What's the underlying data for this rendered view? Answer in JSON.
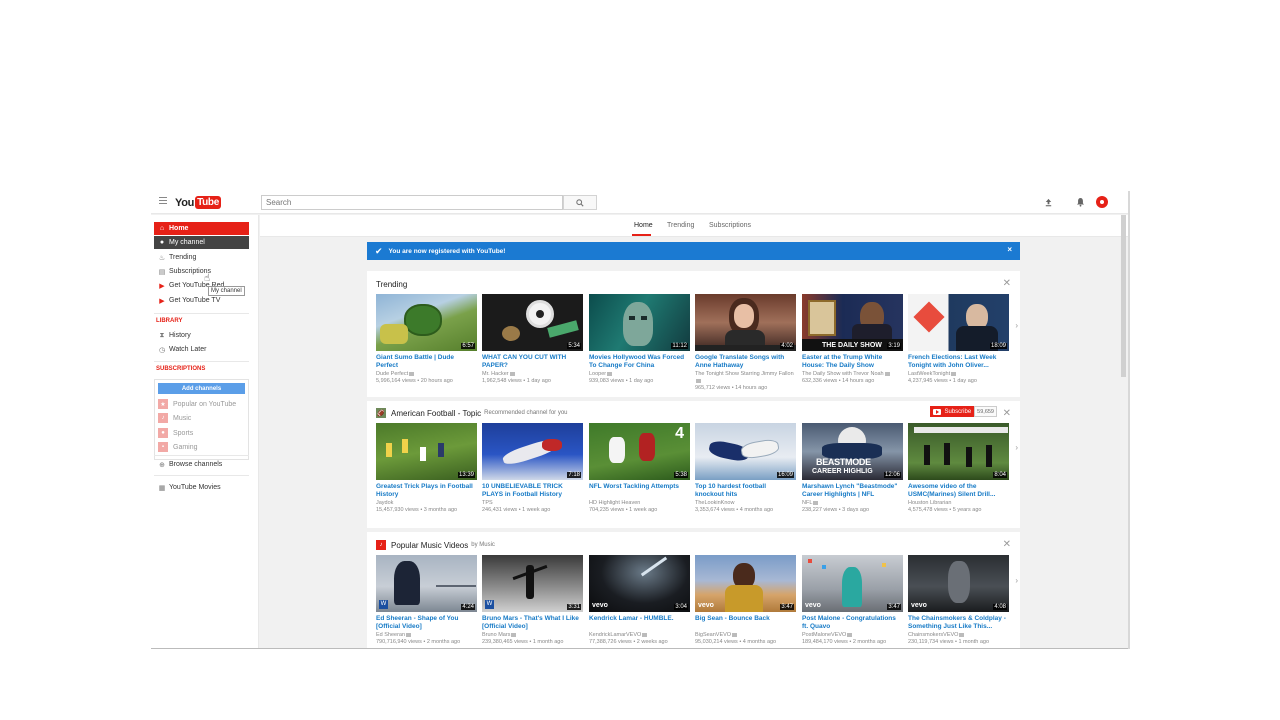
{
  "masthead": {
    "logo_you": "You",
    "logo_tube": "Tube",
    "search_placeholder": "Search"
  },
  "guide": {
    "items": [
      {
        "label": "Home",
        "icon": "home-icon"
      },
      {
        "label": "My channel",
        "icon": "person-icon"
      },
      {
        "label": "Trending",
        "icon": "flame-icon"
      },
      {
        "label": "Subscriptions",
        "icon": "subscriptions-icon"
      },
      {
        "label": "Get YouTube Red",
        "icon": "youtube-red-icon"
      },
      {
        "label": "Get YouTube TV",
        "icon": "youtube-tv-icon"
      }
    ],
    "library_heading": "LIBRARY",
    "library": [
      {
        "label": "History",
        "icon": "hourglass-icon"
      },
      {
        "label": "Watch Later",
        "icon": "clock-icon"
      }
    ],
    "subscriptions_heading": "SUBSCRIPTIONS",
    "add_channels": "Add channels",
    "subscriptions": [
      "Popular on YouTube",
      "Music",
      "Sports",
      "Gaming"
    ],
    "browse_channels": "Browse channels",
    "youtube_movies": "YouTube Movies",
    "tooltip": "My channel"
  },
  "tabs": [
    "Home",
    "Trending",
    "Subscriptions"
  ],
  "banner": {
    "text": "You are now registered with YouTube!",
    "close": "×"
  },
  "shelves": [
    {
      "title": "Trending",
      "subtitle": "",
      "videos": [
        {
          "title": "Giant Sumo Battle | Dude Perfect",
          "channel": "Dude Perfect",
          "meta": "5,996,164 views • 20 hours ago",
          "duration": "6:57"
        },
        {
          "title": "WHAT CAN YOU CUT WITH PAPER?",
          "channel": "Mr. Hacker",
          "meta": "1,962,548 views • 1 day ago",
          "duration": "5:34"
        },
        {
          "title": "Movies Hollywood Was Forced To Change For China",
          "channel": "Looper",
          "meta": "939,083 views • 1 day ago",
          "duration": "11:12"
        },
        {
          "title": "Google Translate Songs with Anne Hathaway",
          "channel": "The Tonight Show Starring Jimmy Fallon",
          "meta": "965,712 views • 14 hours ago",
          "duration": "4:02"
        },
        {
          "title": "Easter at the Trump White House: The Daily Show",
          "channel": "The Daily Show with Trevor Noah",
          "meta": "632,336 views • 14 hours ago",
          "duration": "3:19"
        },
        {
          "title": "French Elections: Last Week Tonight with John Oliver...",
          "channel": "LastWeekTonight",
          "meta": "4,237,945 views • 1 day ago",
          "duration": "18:09"
        }
      ]
    },
    {
      "title": "American Football - Topic",
      "subtitle": "Recommended channel for you",
      "subscribe": "Subscribe",
      "subscriber_count": "59,659",
      "videos": [
        {
          "title": "Greatest Trick Plays in Football History",
          "channel": "Jaydok",
          "meta": "15,457,930 views • 3 months ago",
          "duration": "13:39"
        },
        {
          "title": "10 UNBELIEVABLE TRICK PLAYS in Football History",
          "channel": "TPS",
          "meta": "246,431 views • 1 week ago",
          "duration": "7:18"
        },
        {
          "title": "NFL Worst Tackling Attempts",
          "channel": "HD Highlight Heaven",
          "meta": "704,235 views • 1 week ago",
          "duration": "5:38"
        },
        {
          "title": "Top 10 hardest football knockout hits",
          "channel": "TheLookinKnow",
          "meta": "3,353,674 views • 4 months ago",
          "duration": "16:09"
        },
        {
          "title": "Marshawn Lynch \"Beastmode\" Career Highlights | NFL",
          "channel": "NFL",
          "meta": "238,227 views • 3 days ago",
          "duration": "12:06"
        },
        {
          "title": "Awesome video of the USMC(Marines) Silent Drill...",
          "channel": "Houston Librarian",
          "meta": "4,575,478 views • 5 years ago",
          "duration": "8:04"
        }
      ]
    },
    {
      "title": "Popular Music Videos",
      "subtitle": "by Music",
      "videos": [
        {
          "title": "Ed Sheeran - Shape of You [Official Video]",
          "channel": "Ed Sheeran",
          "meta": "790,716,940 views • 2 months ago",
          "duration": "4:24"
        },
        {
          "title": "Bruno Mars - That's What I Like [Official Video]",
          "channel": "Bruno Mars",
          "meta": "239,380,465 views • 1 month ago",
          "duration": "3:31"
        },
        {
          "title": "Kendrick Lamar - HUMBLE.",
          "channel": "KendrickLamarVEVO",
          "meta": "77,388,726 views • 2 weeks ago",
          "duration": "3:04"
        },
        {
          "title": "Big Sean - Bounce Back",
          "channel": "BigSeanVEVO",
          "meta": "95,030,214 views • 4 months ago",
          "duration": "3:47"
        },
        {
          "title": "Post Malone - Congratulations ft. Quavo",
          "channel": "PostMaloneVEVO",
          "meta": "189,484,170 views • 2 months ago",
          "duration": "3:47"
        },
        {
          "title": "The Chainsmokers & Coldplay - Something Just Like This...",
          "channel": "ChainsmokersVEVO",
          "meta": "230,119,734 views • 1 month ago",
          "duration": "4:08"
        }
      ]
    }
  ],
  "overlays": {
    "vevo": "vevo",
    "daily_show": "THE DAILY SHOW",
    "beastmode": "BEASTMODE",
    "career": "CAREER HIGHLIG"
  },
  "colors": {
    "brand_red": "#e62117",
    "link_blue": "#167ac6",
    "banner_blue": "#1b7ad2"
  }
}
